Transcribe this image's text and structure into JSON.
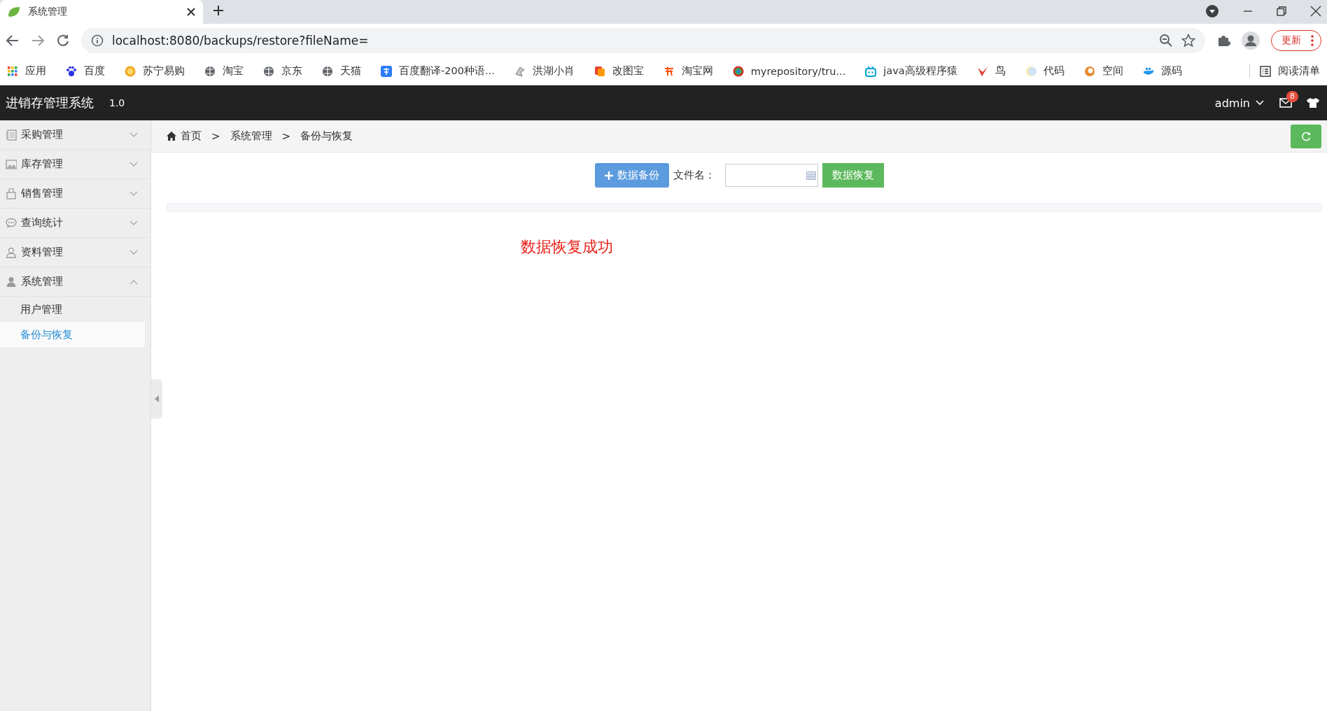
{
  "browser": {
    "tab": {
      "title": "系统管理"
    },
    "url": "localhost:8080/backups/restore?fileName=",
    "update_button": "更新",
    "bookmarks": [
      {
        "label": "应用"
      },
      {
        "label": "百度"
      },
      {
        "label": "苏宁易购"
      },
      {
        "label": "淘宝"
      },
      {
        "label": "京东"
      },
      {
        "label": "天猫"
      },
      {
        "label": "百度翻译-200种语..."
      },
      {
        "label": "洪湖小肖"
      },
      {
        "label": "改图宝"
      },
      {
        "label": "淘宝网"
      },
      {
        "label": "myrepository/tru..."
      },
      {
        "label": "java高级程序猿"
      },
      {
        "label": "鸟"
      },
      {
        "label": "代码"
      },
      {
        "label": "空间"
      },
      {
        "label": "源码"
      }
    ],
    "reading_list": "阅读清单"
  },
  "app": {
    "title": "进销存管理系统",
    "version": "1.0",
    "user": "admin",
    "mail_badge": "8"
  },
  "sidebar": {
    "items": [
      {
        "label": "采购管理",
        "expanded": false
      },
      {
        "label": "库存管理",
        "expanded": false
      },
      {
        "label": "销售管理",
        "expanded": false
      },
      {
        "label": "查询统计",
        "expanded": false
      },
      {
        "label": "资料管理",
        "expanded": false
      },
      {
        "label": "系统管理",
        "expanded": true,
        "children": [
          {
            "label": "用户管理",
            "selected": false
          },
          {
            "label": "备份与恢复",
            "selected": true
          }
        ]
      }
    ]
  },
  "breadcrumb": [
    {
      "kind": "home",
      "label": "首页"
    },
    {
      "kind": "separator",
      "label": ">"
    },
    {
      "kind": "link",
      "label": "系统管理"
    },
    {
      "kind": "separator",
      "label": ">"
    },
    {
      "kind": "link",
      "label": "备份与恢复"
    }
  ],
  "toolbar": {
    "backup_button": "数据备份",
    "file_label": "文件名：",
    "restore_button": "数据恢复"
  },
  "message": "数据恢复成功"
}
